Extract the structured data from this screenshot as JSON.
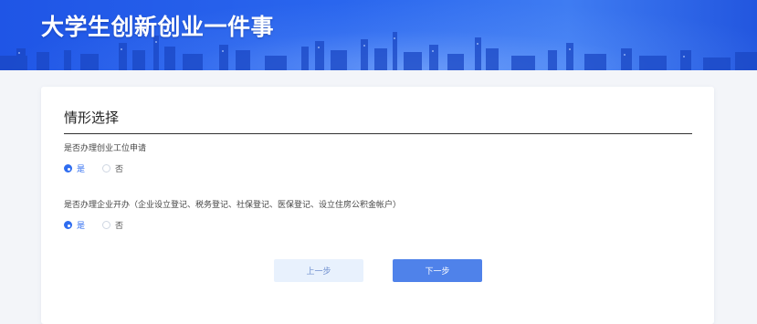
{
  "header": {
    "title": "大学生创新创业一件事"
  },
  "section": {
    "title": "情形选择"
  },
  "questions": [
    {
      "label": "是否办理创业工位申请",
      "options": [
        "是",
        "否"
      ],
      "selected": "是"
    },
    {
      "label": "是否办理企业开办（企业设立登记、税务登记、社保登记、医保登记、设立住房公积金帐户）",
      "options": [
        "是",
        "否"
      ],
      "selected": "是"
    }
  ],
  "buttons": {
    "prev": "上一步",
    "next": "下一步"
  },
  "colors": {
    "accent": "#2f6df0",
    "banner": "#2a66ee",
    "next_button": "#4f82ea",
    "prev_button": "#e8f1fd"
  }
}
